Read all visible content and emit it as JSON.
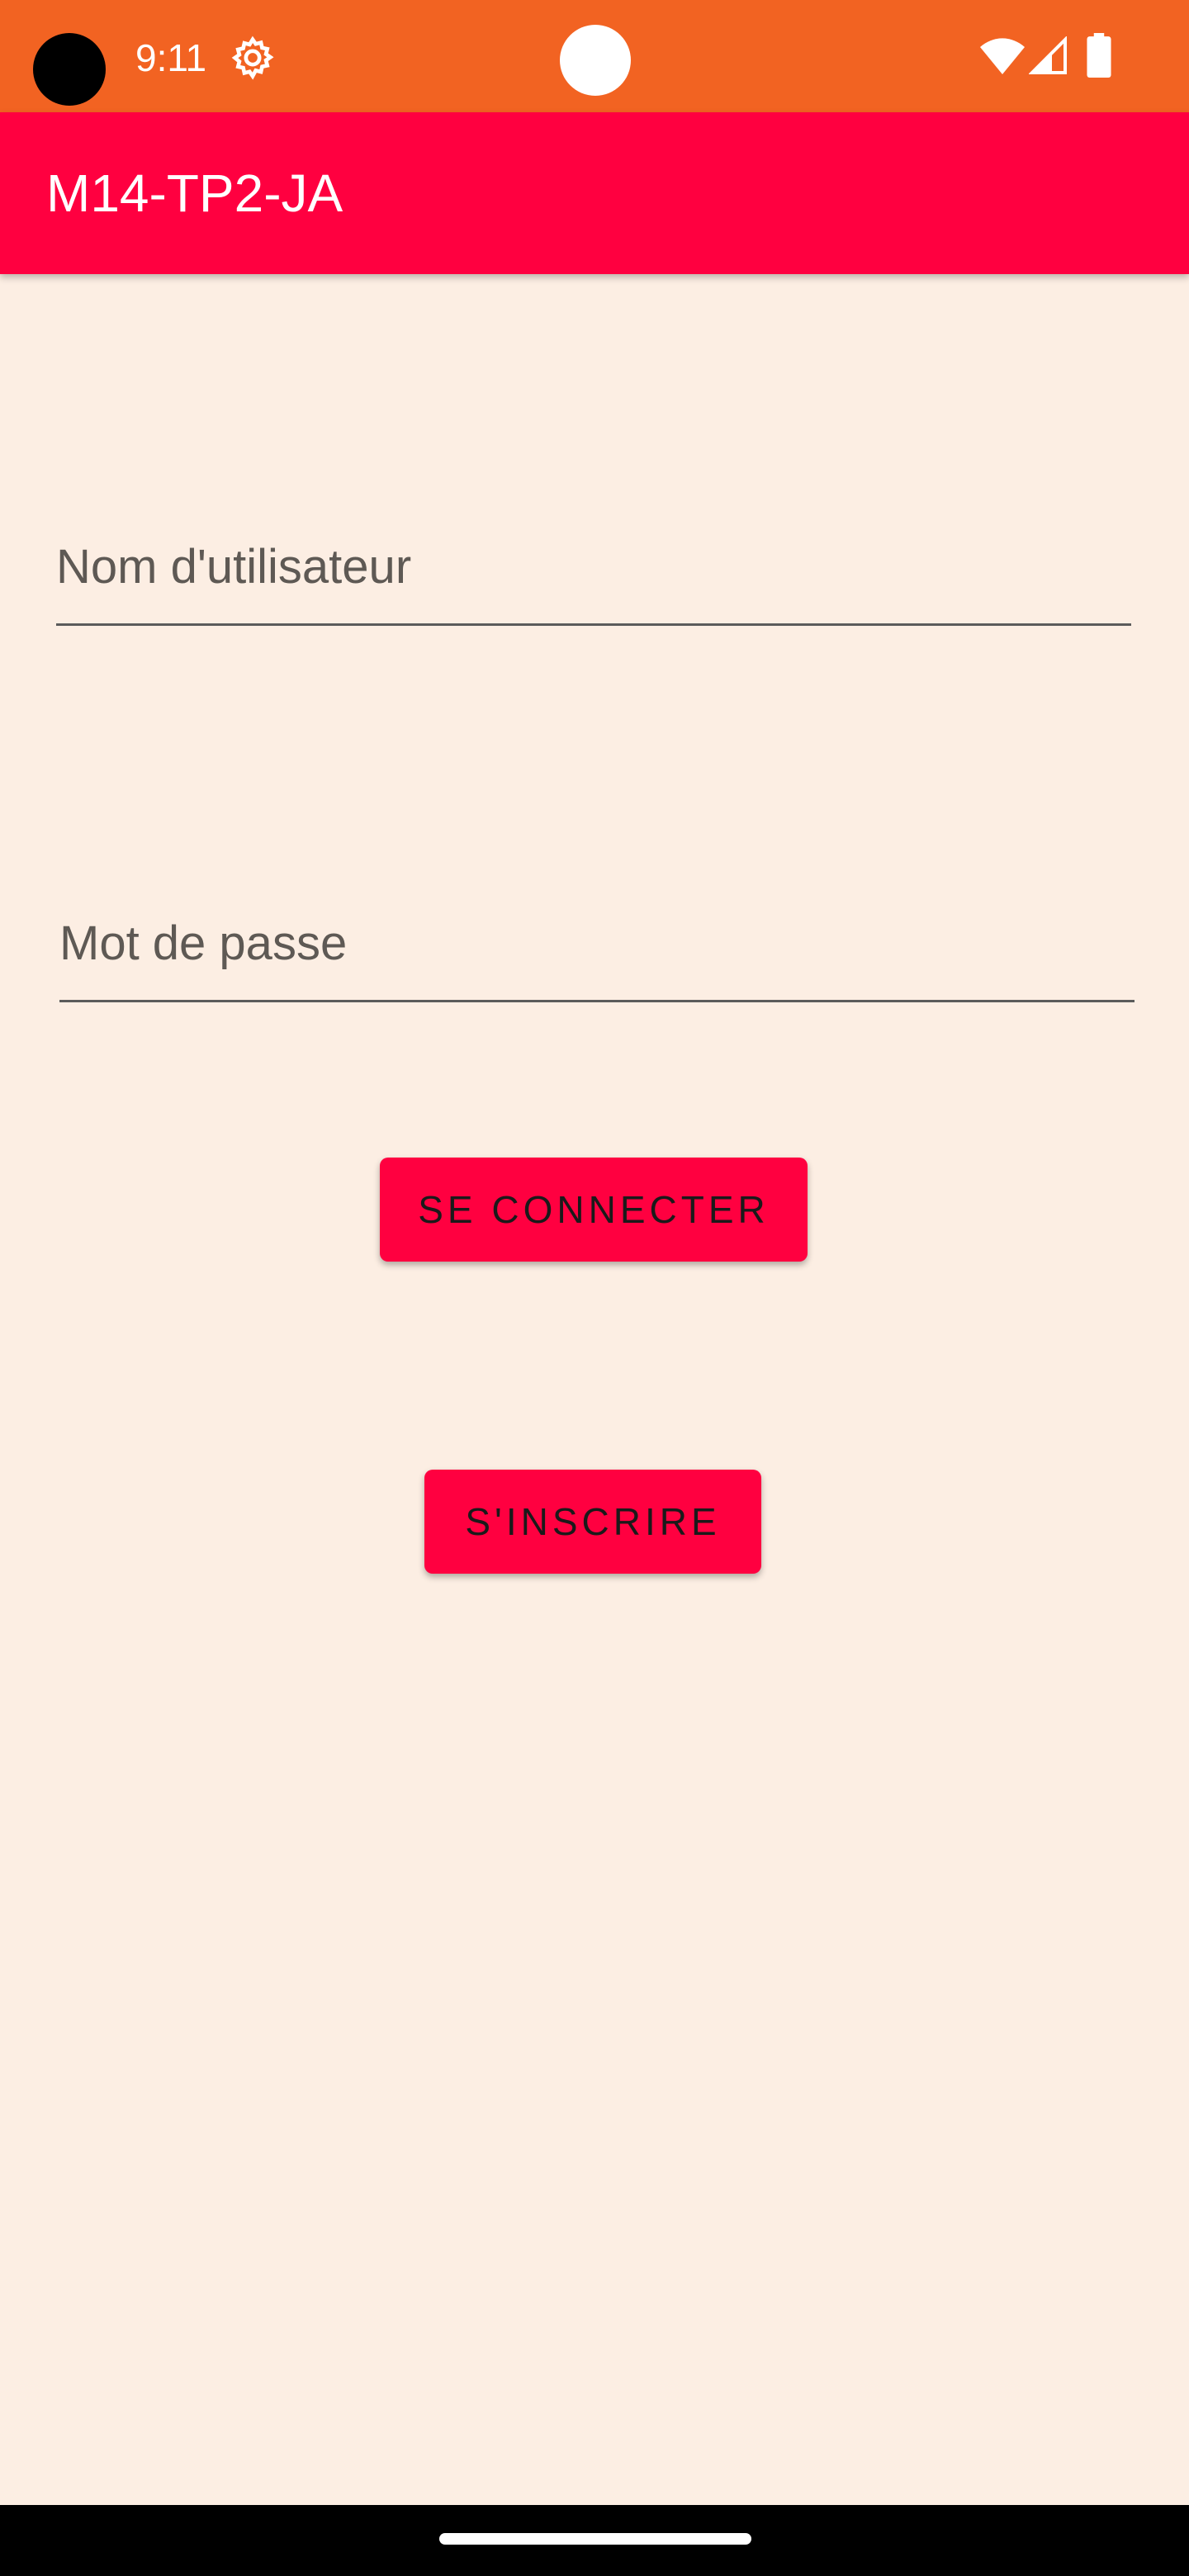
{
  "status_bar": {
    "time": "9:11",
    "background_color": "#F26322",
    "icons": [
      "settings-icon",
      "wifi-icon",
      "signal-icon",
      "battery-icon"
    ]
  },
  "app_bar": {
    "title": "M14-TP2-JA",
    "background_color": "#FF0040"
  },
  "form": {
    "username_placeholder": "Nom d'utilisateur",
    "username_value": "",
    "password_placeholder": "Mot de passe",
    "password_value": "",
    "login_label": "SE CONNECTER",
    "signup_label": "S'INSCRIRE"
  },
  "colors": {
    "accent": "#FF0040",
    "background": "#FCEEE3",
    "status_bar": "#F26322"
  }
}
